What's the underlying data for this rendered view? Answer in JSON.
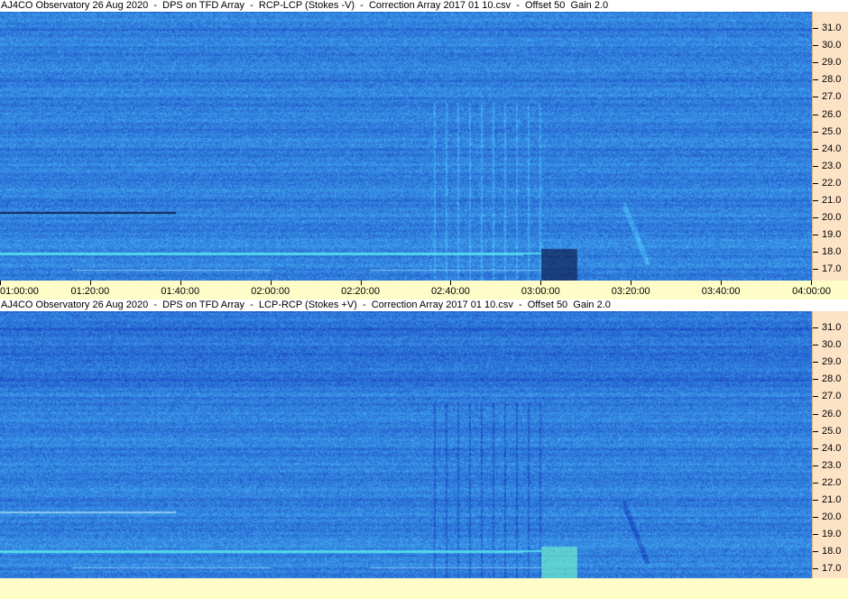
{
  "panels": [
    {
      "title": "AJ4CO Observatory 26 Aug 2020  -  DPS on TFD Array  -  RCP-LCP (Stokes -V)  -  Correction Array 2017 01 10.csv  -  Offset 50  Gain 2.0",
      "mode": "negative-V"
    },
    {
      "title": "AJ4CO Observatory 26 Aug 2020  -  DPS on TFD Array  -  LCP-RCP (Stokes +V)  -  Correction Array 2017 01 10.csv  -  Offset 50  Gain 2.0",
      "mode": "positive-V"
    }
  ],
  "frequency_labels": [
    "31.0",
    "30.0",
    "29.0",
    "28.0",
    "27.0",
    "26.0",
    "25.0",
    "24.0",
    "23.0",
    "22.0",
    "21.0",
    "20.0",
    "19.0",
    "18.0",
    "17.0"
  ],
  "time_labels": [
    "01:00:00",
    "01:20:00",
    "01:40:00",
    "02:00:00",
    "02:20:00",
    "02:40:00",
    "03:00:00",
    "03:20:00",
    "03:40:00",
    "04:00:00"
  ],
  "colors": {
    "spectrogram_base": "#1a5fe0",
    "axis_background_freq": "#fde3c6",
    "axis_background_time": "#fefdc8",
    "burst_highlight": "#3fd0f0"
  }
}
